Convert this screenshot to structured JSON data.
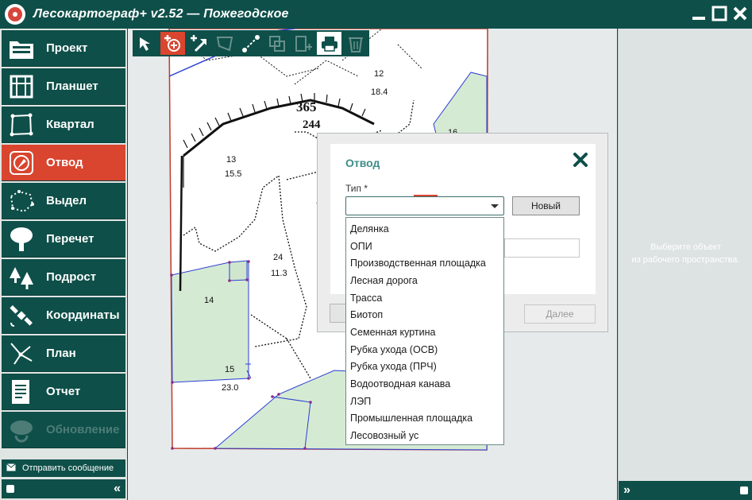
{
  "window": {
    "title": "Лесокартограф+ v2.52 — Пожегодское",
    "minimize_icon": "minimize-icon",
    "maximize_icon": "maximize-icon",
    "close_icon": "close-icon"
  },
  "sidebar": {
    "items": [
      {
        "label": "Проект",
        "icon": "folder-icon"
      },
      {
        "label": "Планшет",
        "icon": "map-sheet-icon"
      },
      {
        "label": "Квартал",
        "icon": "quarter-polygon-icon"
      },
      {
        "label": "Отвод",
        "icon": "compass-icon",
        "active": true
      },
      {
        "label": "Выдел",
        "icon": "dotted-area-icon"
      },
      {
        "label": "Перечет",
        "icon": "tree-icon"
      },
      {
        "label": "Подрост",
        "icon": "young-trees-icon"
      },
      {
        "label": "Координаты",
        "icon": "satellite-icon"
      },
      {
        "label": "План",
        "icon": "plan-lines-icon"
      },
      {
        "label": "Отчет",
        "icon": "report-icon"
      },
      {
        "label": "Обновление",
        "icon": "update-icon",
        "disabled": true
      }
    ],
    "send_message": "Отправить сообщение",
    "collapse_symbol": "«"
  },
  "toolbar": {
    "tools": [
      "select-arrow-icon",
      "add-point-icon",
      "add-arrow-icon",
      "polygon-tool-icon",
      "line-tool-icon",
      "copy-tool-icon",
      "split-tool-icon",
      "print-icon",
      "delete-icon"
    ]
  },
  "map": {
    "labels": {
      "block_top": "365",
      "block_bottom": "244",
      "v12": "12",
      "v12_area": "18.4",
      "v13": "13",
      "v13_area": "15.5",
      "v14": "14",
      "v15": "15",
      "v15_area": "23.0",
      "v16": "16",
      "v24": "24",
      "v24_area": "11.3"
    },
    "colors": {
      "plot_fill": "#d5ead3",
      "boundary": "#c0392b",
      "plot_line": "#2b3fd4"
    }
  },
  "dialog": {
    "title": "Отвод",
    "type_label": "Тип *",
    "new_button": "Новый",
    "next_button": "Далее"
  },
  "dropdown": {
    "options": [
      "Делянка",
      "ОПИ",
      "Производственная площадка",
      "Лесная дорога",
      "Трасса",
      "Биотоп",
      "Семенная куртина",
      "Рубка ухода (ОСВ)",
      "Рубка ухода (ПРЧ)",
      "Водоотводная канава",
      "ЛЭП",
      "Промышленная площадка",
      "Лесовозный ус"
    ]
  },
  "right_panel": {
    "message_line1": "Выберите объект",
    "message_line2": "из рабочего пространства."
  },
  "colors": {
    "primary": "#0e4f49",
    "accent": "#d9452f",
    "title_teal": "#3d8d8a"
  }
}
